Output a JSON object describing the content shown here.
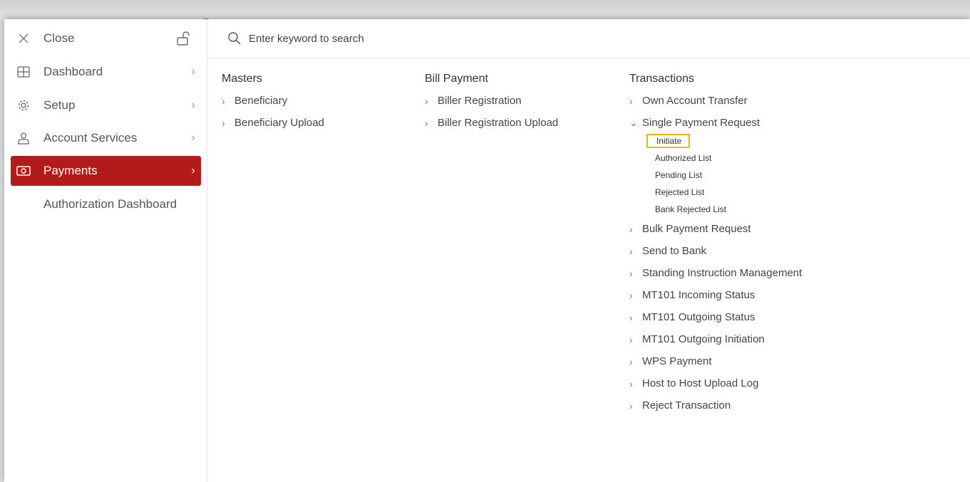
{
  "sidebar": {
    "close_label": "Close",
    "items": [
      {
        "label": "Dashboard",
        "icon": "grid-icon"
      },
      {
        "label": "Setup",
        "icon": "gear-icon"
      },
      {
        "label": "Account Services",
        "icon": "user-icon"
      },
      {
        "label": "Payments",
        "icon": "money-icon"
      }
    ],
    "authorization_dashboard": "Authorization Dashboard"
  },
  "search": {
    "placeholder": "Enter keyword to search"
  },
  "columns": {
    "masters": {
      "title": "Masters",
      "links": [
        "Beneficiary",
        "Beneficiary Upload"
      ]
    },
    "bill_payment": {
      "title": "Bill Payment",
      "links": [
        "Biller Registration",
        "Biller Registration Upload"
      ]
    },
    "transactions": {
      "title": "Transactions",
      "links": [
        "Own Account Transfer",
        "Single Payment Request",
        "Bulk Payment Request",
        "Send to Bank",
        "Standing Instruction Management",
        "MT101 Incoming Status",
        "MT101 Outgoing Status",
        "MT101 Outgoing Initiation",
        "WPS Payment",
        "Host to Host Upload Log",
        "Reject Transaction"
      ],
      "single_payment_sub": [
        "Initiate",
        "Authorized List",
        "Pending List",
        "Rejected List",
        "Bank Rejected List"
      ]
    }
  },
  "colors": {
    "accent": "#b31b1b",
    "focus": "#f0b400"
  }
}
